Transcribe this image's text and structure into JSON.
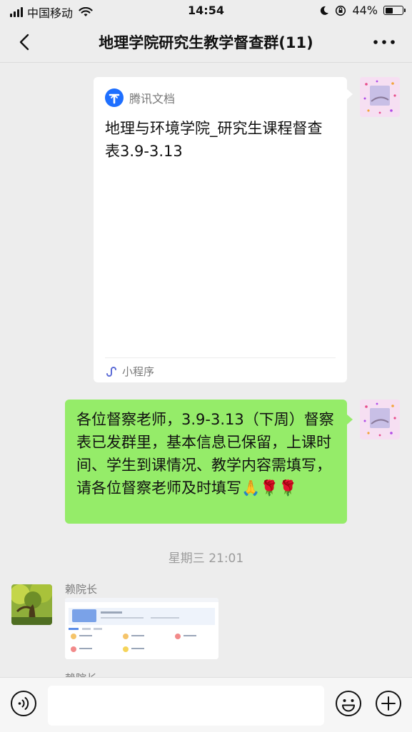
{
  "status_bar": {
    "carrier": "中国移动",
    "time": "14:54",
    "battery_text": "44%",
    "battery_level": 0.44,
    "icons": [
      "signal-icon",
      "wifi-icon",
      "moon-icon",
      "rotation-lock-icon",
      "battery-icon"
    ]
  },
  "nav": {
    "title": "地理学院研究生教学督查群(11)",
    "back_icon": "chevron-left-icon",
    "more_icon": "more-dots-icon"
  },
  "messages": {
    "card": {
      "app_name": "腾讯文档",
      "title": "地理与环境学院_研究生课程督查表3.9-3.13",
      "footer_label": "小程序",
      "logo_icon": "tencent-docs-logo-icon",
      "footer_icon": "mini-program-icon"
    },
    "text_message": "各位督察老师，3.9-3.13（下周）督察表已发群里，基本信息已保留，上课时间、学生到课情况、教学内容需填写，请各位督察老师及时填写🙏🌹🌹",
    "time_divider": "星期三 21:01",
    "sender_name": "赖院长",
    "next_sender_partial": "赖院长"
  },
  "input_bar": {
    "placeholder": "",
    "voice_icon": "voice-icon",
    "emoji_icon": "emoji-icon",
    "plus_icon": "plus-icon"
  },
  "colors": {
    "background": "#ededed",
    "bubble_green": "#95ec69",
    "card_white": "#ffffff",
    "tencent_blue": "#1e6fff"
  }
}
